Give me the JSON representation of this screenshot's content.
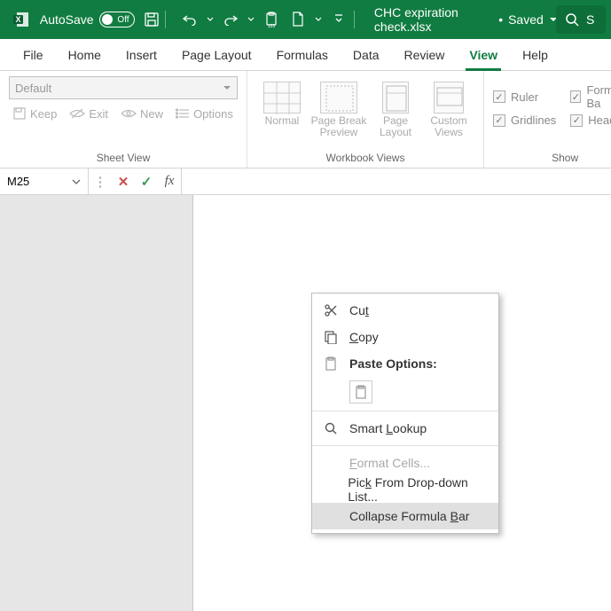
{
  "titlebar": {
    "autosave_label": "AutoSave",
    "autosave_state": "Off",
    "filename": "CHC expiration check.xlsx",
    "save_status": "Saved",
    "search_placeholder": "S"
  },
  "tabs": {
    "file": "File",
    "home": "Home",
    "insert": "Insert",
    "page_layout": "Page Layout",
    "formulas": "Formulas",
    "data": "Data",
    "review": "Review",
    "view": "View",
    "help": "Help"
  },
  "ribbon": {
    "sheet_view": {
      "combo": "Default",
      "keep": "Keep",
      "exit": "Exit",
      "new": "New",
      "options": "Options",
      "group": "Sheet View"
    },
    "workbook_views": {
      "normal": "Normal",
      "page_break": "Page Break Preview",
      "page_layout": "Page Layout",
      "custom": "Custom Views",
      "group": "Workbook Views"
    },
    "show": {
      "ruler": "Ruler",
      "formula_bar": "Formula Ba",
      "gridlines": "Gridlines",
      "headings": "Headings",
      "group": "Show"
    }
  },
  "formula_bar": {
    "name_box": "M25"
  },
  "context_menu": {
    "cut": "t",
    "cut_prefix": "Cu",
    "copy": "opy",
    "copy_prefix": "C",
    "paste_options": "Paste Options:",
    "smart_lookup": "Smart ",
    "smart_lookup_u": "L",
    "smart_lookup_suffix": "ookup",
    "format_cells": "ormat Cells...",
    "format_cells_prefix": "F",
    "pick": "Pic",
    "pick_u": "k",
    "pick_suffix": " From Drop-down List...",
    "collapse": "Collapse Formula ",
    "collapse_u": "B",
    "collapse_suffix": "ar"
  }
}
